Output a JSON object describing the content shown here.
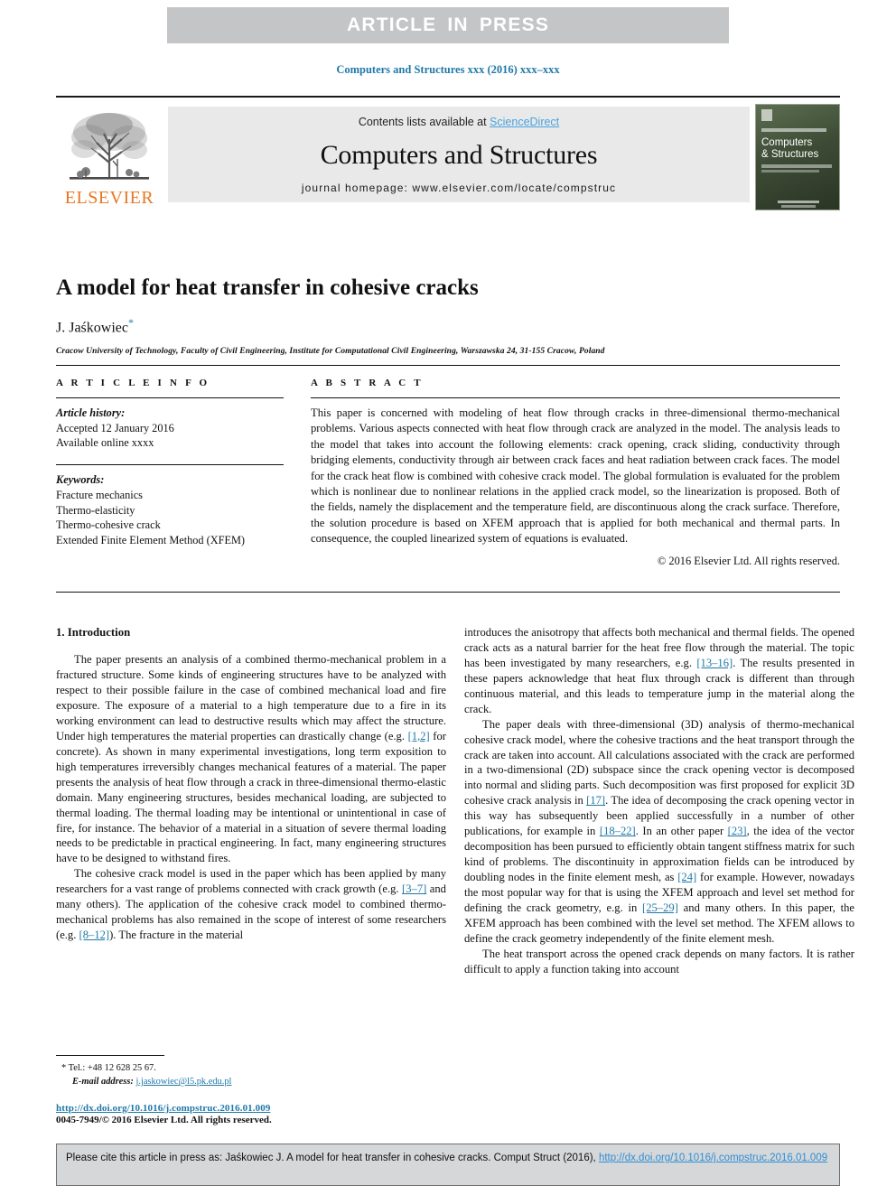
{
  "banner": {
    "text": "ARTICLE  IN  PRESS"
  },
  "journal_ref": "Computers and Structures xxx (2016) xxx–xxx",
  "masthead": {
    "contents_prefix": "Contents lists available at ",
    "sciencedirect": "ScienceDirect",
    "journal_name": "Computers and Structures",
    "homepage": "journal homepage: www.elsevier.com/locate/compstruc",
    "publisher_word": "ELSEVIER",
    "cover_title_line1": "Computers",
    "cover_title_line2": "& Structures"
  },
  "article": {
    "title": "A model for heat transfer in cohesive cracks",
    "author": "J. Jaśkowiec",
    "corresponding_mark": "*",
    "affiliation": "Cracow University of Technology, Faculty of Civil Engineering, Institute for Computational Civil Engineering, Warszawska 24, 31-155 Cracow, Poland"
  },
  "info": {
    "heading": "A R T I C L E   I N F O",
    "history_label": "Article history:",
    "history_lines": [
      "Accepted 12 January 2016",
      "Available online xxxx"
    ],
    "keywords_label": "Keywords:",
    "keywords": [
      "Fracture mechanics",
      "Thermo-elasticity",
      "Thermo-cohesive crack",
      "Extended Finite Element Method (XFEM)"
    ]
  },
  "abstract": {
    "heading": "A B S T R A C T",
    "body": "This paper is concerned with modeling of heat flow through cracks in three-dimensional thermo-mechanical problems. Various aspects connected with heat flow through crack are analyzed in the model. The analysis leads to the model that takes into account the following elements: crack opening, crack sliding, conductivity through bridging elements, conductivity through air between crack faces and heat radiation between crack faces. The model for the crack heat flow is combined with cohesive crack model. The global formulation is evaluated for the problem which is nonlinear due to nonlinear relations in the applied crack model, so the linearization is proposed. Both of the fields, namely the displacement and the temperature field, are discontinuous along the crack surface. Therefore, the solution procedure is based on XFEM approach that is applied for both mechanical and thermal parts. In consequence, the coupled linearized system of equations is evaluated.",
    "copyright": "© 2016 Elsevier Ltd. All rights reserved."
  },
  "introduction": {
    "section_title": "1. Introduction",
    "left_p1_a": "The paper presents an analysis of a combined thermo-mechanical problem in a fractured structure. Some kinds of engineering structures have to be analyzed with respect to their possible failure in the case of combined mechanical load and fire exposure. The exposure of a material to a high temperature due to a fire in its working environment can lead to destructive results which may affect the structure. Under high temperatures the material properties can drastically change (e.g. ",
    "left_p1_cite1": "[1,2]",
    "left_p1_b": " for concrete). As shown in many experimental investigations, long term exposition to high temperatures irreversibly changes mechanical features of a material. The paper presents the analysis of heat flow through a crack in three-dimensional thermo-elastic domain. Many engineering structures, besides mechanical loading, are subjected to thermal loading. The thermal loading may be intentional or unintentional in case of fire, for instance. The behavior of a material in a situation of severe thermal loading needs to be predictable in practical engineering. In fact, many engineering structures have to be designed to withstand fires.",
    "left_p2_a": "The cohesive crack model is used in the paper which has been applied by many researchers for a vast range of problems connected with crack growth (e.g. ",
    "left_p2_cite1": "[3–7]",
    "left_p2_b": " and many others). The application of the cohesive crack model to combined thermo-mechanical problems has also remained in the scope of interest of some researchers (e.g. ",
    "left_p2_cite2": "[8–12]",
    "left_p2_c": "). The fracture in the material",
    "right_p1_a": "introduces the anisotropy that affects both mechanical and thermal fields. The opened crack acts as a natural barrier for the heat free flow through the material. The topic has been investigated by many researchers, e.g. ",
    "right_p1_cite1": "[13–16]",
    "right_p1_b": ". The results presented in these papers acknowledge that heat flux through crack is different than through continuous material, and this leads to temperature jump in the material along the crack.",
    "right_p2_a": "The paper deals with three-dimensional (3D) analysis of thermo-mechanical cohesive crack model, where the cohesive tractions and the heat transport through the crack are taken into account. All calculations associated with the crack are performed in a two-dimensional (2D) subspace since the crack opening vector is decomposed into normal and sliding parts. Such decomposition was first proposed for explicit 3D cohesive crack analysis in ",
    "right_p2_cite1": "[17]",
    "right_p2_b": ". The idea of decomposing the crack opening vector in this way has subsequently been applied successfully in a number of other publications, for example in ",
    "right_p2_cite2": "[18–22]",
    "right_p2_c": ". In an other paper ",
    "right_p2_cite3": "[23]",
    "right_p2_d": ", the idea of the vector decomposition has been pursued to efficiently obtain tangent stiffness matrix for such kind of problems. The discontinuity in approximation fields can be introduced by doubling nodes in the finite element mesh, as ",
    "right_p2_cite4": "[24]",
    "right_p2_e": " for example. However, nowadays the most popular way for that is using the XFEM approach and level set method for defining the crack geometry, e.g. in ",
    "right_p2_cite5": "[25–29]",
    "right_p2_f": " and many others. In this paper, the XFEM approach has been combined with the level set method. The XFEM allows to define the crack geometry independently of the finite element mesh.",
    "right_p3": "The heat transport across the opened crack depends on many factors. It is rather difficult to apply a function taking into account"
  },
  "footnote": {
    "star": "*",
    "tel": "Tel.: +48 12 628 25 67.",
    "email_label": "E-mail address:",
    "email": "j.jaskowiec@l5.pk.edu.pl",
    "doi": "http://dx.doi.org/10.1016/j.compstruc.2016.01.009",
    "issn": "0045-7949/© 2016 Elsevier Ltd. All rights reserved."
  },
  "cite_box": {
    "text": "Please cite this article in press as: Jaśkowiec J. A model for heat transfer in cohesive cracks. Comput Struct (2016), ",
    "link": "http://dx.doi.org/10.1016/j.compstruc.2016.01.009"
  },
  "colors": {
    "banner_gray": "#c3c5c7",
    "link_blue": "#1f78a8",
    "sciencedirect_blue": "#4aa3df",
    "elsevier_orange": "#e87722",
    "cite_box_gray": "#d6d7d9"
  }
}
